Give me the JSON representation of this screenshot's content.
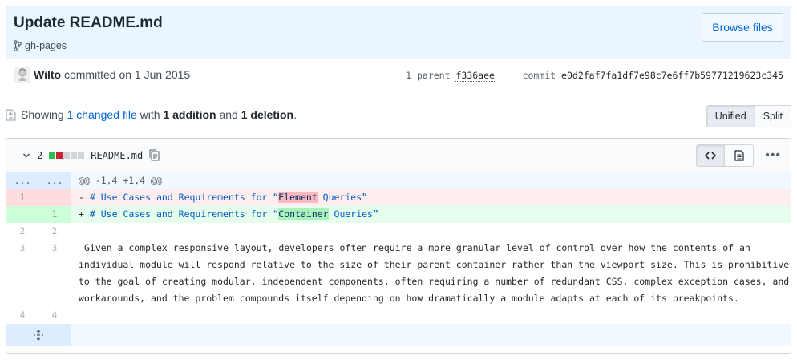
{
  "commit": {
    "title": "Update README.md",
    "branch": "gh-pages",
    "browse_label": "Browse files",
    "author": "Wilto",
    "committed_text": "committed on 1 Jun 2015",
    "parent_label": "1 parent",
    "parent_sha": "f336aee",
    "commit_label": "commit",
    "commit_sha": "e0d2faf7fa1df7e98c7e6ff7b59771219623c345"
  },
  "toc": {
    "showing": "Showing",
    "changed_files": "1 changed file",
    "with": "with",
    "additions": "1 addition",
    "and": "and",
    "deletions": "1 deletion",
    "period": ".",
    "unified_label": "Unified",
    "split_label": "Split"
  },
  "file": {
    "change_count": "2",
    "name": "README.md",
    "diffstat_colors": [
      "#2cbe4e",
      "#cb2431",
      "#d1d5da",
      "#d1d5da",
      "#d1d5da"
    ],
    "hunk": {
      "left": "...",
      "right": "...",
      "header": "@@ -1,4 +1,4 @@"
    },
    "del_line": {
      "old": "1",
      "sign": "-",
      "prefix": "# Use Cases and Requirements for “",
      "highlight": "Element",
      "suffix": " Queries”"
    },
    "add_line": {
      "new": "1",
      "sign": "+",
      "prefix": "# Use Cases and Requirements for “",
      "highlight": "Container",
      "suffix": " Queries”"
    },
    "ctx2": {
      "old": "2",
      "new": "2",
      "text": ""
    },
    "ctx3": {
      "old": "3",
      "new": "3",
      "text": "Given a complex responsive layout, developers often require a more granular level of control over how the contents of an individual module will respond relative to the size of their parent container rather than the viewport size. This is prohibitive to the goal of creating modular, independent components, often requiring a number of redundant CSS, complex exception cases, and workarounds, and the problem compounds itself depending on how dramatically a module adapts at each of its breakpoints."
    },
    "ctx4": {
      "old": "4",
      "new": "4",
      "text": ""
    }
  },
  "icons": {
    "branch": "git-branch-icon",
    "file_diff": "file-diff-icon",
    "chevron": "chevron-down-icon",
    "copy": "clipboard-icon",
    "code": "code-view-icon",
    "rich": "rich-diff-icon",
    "kebab": "kebab-horizontal-icon",
    "expand": "unfold-icon"
  }
}
